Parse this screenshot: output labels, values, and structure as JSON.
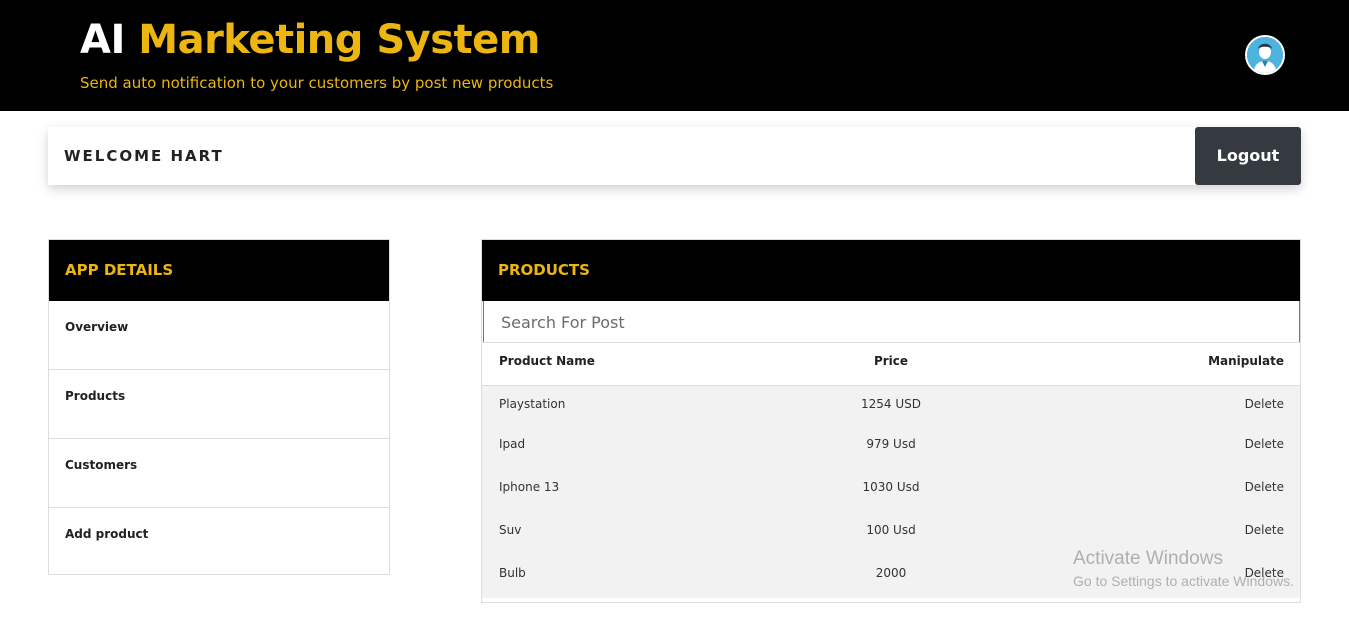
{
  "header": {
    "title_part1": "AI",
    "title_part2": "Marketing System",
    "subtitle": "Send auto notification to your customers by post new products",
    "avatar_icon": "user-avatar-icon",
    "accent_color": "#ecb510"
  },
  "welcome": {
    "text": "WELCOME HART",
    "logout_label": "Logout"
  },
  "sidebar": {
    "title": "APP DETAILS",
    "items": [
      {
        "label": "Overview"
      },
      {
        "label": "Products"
      },
      {
        "label": "Customers"
      },
      {
        "label": "Add product"
      }
    ]
  },
  "products": {
    "title": "PRODUCTS",
    "search_placeholder": "Search For Post",
    "columns": [
      "Product Name",
      "Price",
      "Manipulate"
    ],
    "rows": [
      {
        "name": "Playstation",
        "price": "1254 USD",
        "action": "Delete"
      },
      {
        "name": "Ipad",
        "price": "979 Usd",
        "action": "Delete"
      },
      {
        "name": "Iphone 13",
        "price": "1030 Usd",
        "action": "Delete"
      },
      {
        "name": "Suv",
        "price": "100 Usd",
        "action": "Delete"
      },
      {
        "name": "Bulb",
        "price": "2000",
        "action": "Delete"
      }
    ]
  },
  "watermark": {
    "line1": "Activate Windows",
    "line2": "Go to Settings to activate Windows."
  }
}
